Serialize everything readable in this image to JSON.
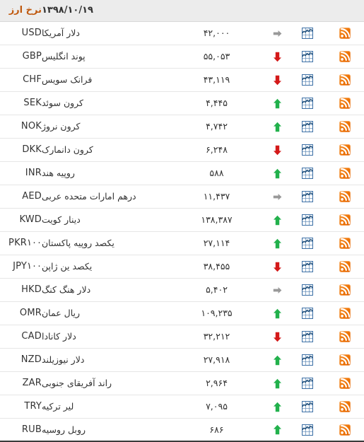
{
  "header": {
    "title": "نرخ ارز",
    "date": "۱۳۹۸/۱۰/۱۹"
  },
  "icons": {
    "rss": "rss-icon",
    "chart": "chart-icon",
    "up": "arrow-up-icon",
    "down": "arrow-down-icon",
    "flat": "arrow-flat-icon"
  },
  "colors": {
    "header_title": "#c05a10",
    "header_background": "#ececec",
    "up": "#22b14c",
    "down": "#d41919",
    "flat": "#999999",
    "rss_orange": "#ee7203",
    "chart_blue": "#3a6ea5",
    "text": "#333333",
    "row_border": "#e6e6e6",
    "table_bottom_border": "#3a3a3a"
  },
  "rows": [
    {
      "code": "USD",
      "name": "دلار آمریکا",
      "value": "۴۲,۰۰۰",
      "trend": "flat"
    },
    {
      "code": "GBP",
      "name": "پوند انگلیس",
      "value": "۵۵,۰۵۳",
      "trend": "down"
    },
    {
      "code": "CHF",
      "name": "فرانک سویس",
      "value": "۴۳,۱۱۹",
      "trend": "down"
    },
    {
      "code": "SEK",
      "name": "کرون سوئد",
      "value": "۴,۴۴۵",
      "trend": "up"
    },
    {
      "code": "NOK",
      "name": "کرون نروژ",
      "value": "۴,۷۴۲",
      "trend": "up"
    },
    {
      "code": "DKK",
      "name": "کرون دانمارک",
      "value": "۶,۲۴۸",
      "trend": "down"
    },
    {
      "code": "INR",
      "name": "روپیه هند",
      "value": "۵۸۸",
      "trend": "up"
    },
    {
      "code": "AED",
      "name": "درهم امارات متحده عربی",
      "value": "۱۱,۴۳۷",
      "trend": "flat"
    },
    {
      "code": "KWD",
      "name": "دینار کویت",
      "value": "۱۳۸,۳۸۷",
      "trend": "up"
    },
    {
      "code": "PKR۱۰۰",
      "name": "یکصد روپیه پاکستان",
      "value": "۲۷,۱۱۴",
      "trend": "up"
    },
    {
      "code": "JPY۱۰۰",
      "name": "یکصد ین ژاپن",
      "value": "۳۸,۴۵۵",
      "trend": "down"
    },
    {
      "code": "HKD",
      "name": "دلار هنگ کنگ",
      "value": "۵,۴۰۲",
      "trend": "flat"
    },
    {
      "code": "OMR",
      "name": "ریال عمان",
      "value": "۱۰۹,۲۳۵",
      "trend": "up"
    },
    {
      "code": "CAD",
      "name": "دلار کانادا",
      "value": "۳۲,۲۱۲",
      "trend": "down"
    },
    {
      "code": "NZD",
      "name": "دلار نیوزیلند",
      "value": "۲۷,۹۱۸",
      "trend": "up"
    },
    {
      "code": "ZAR",
      "name": "راند آفریقای جنوبی",
      "value": "۲,۹۶۴",
      "trend": "up"
    },
    {
      "code": "TRY",
      "name": "لیر ترکیه",
      "value": "۷,۰۹۵",
      "trend": "up"
    },
    {
      "code": "RUB",
      "name": "روبل روسیه",
      "value": "۶۸۶",
      "trend": "up"
    }
  ]
}
